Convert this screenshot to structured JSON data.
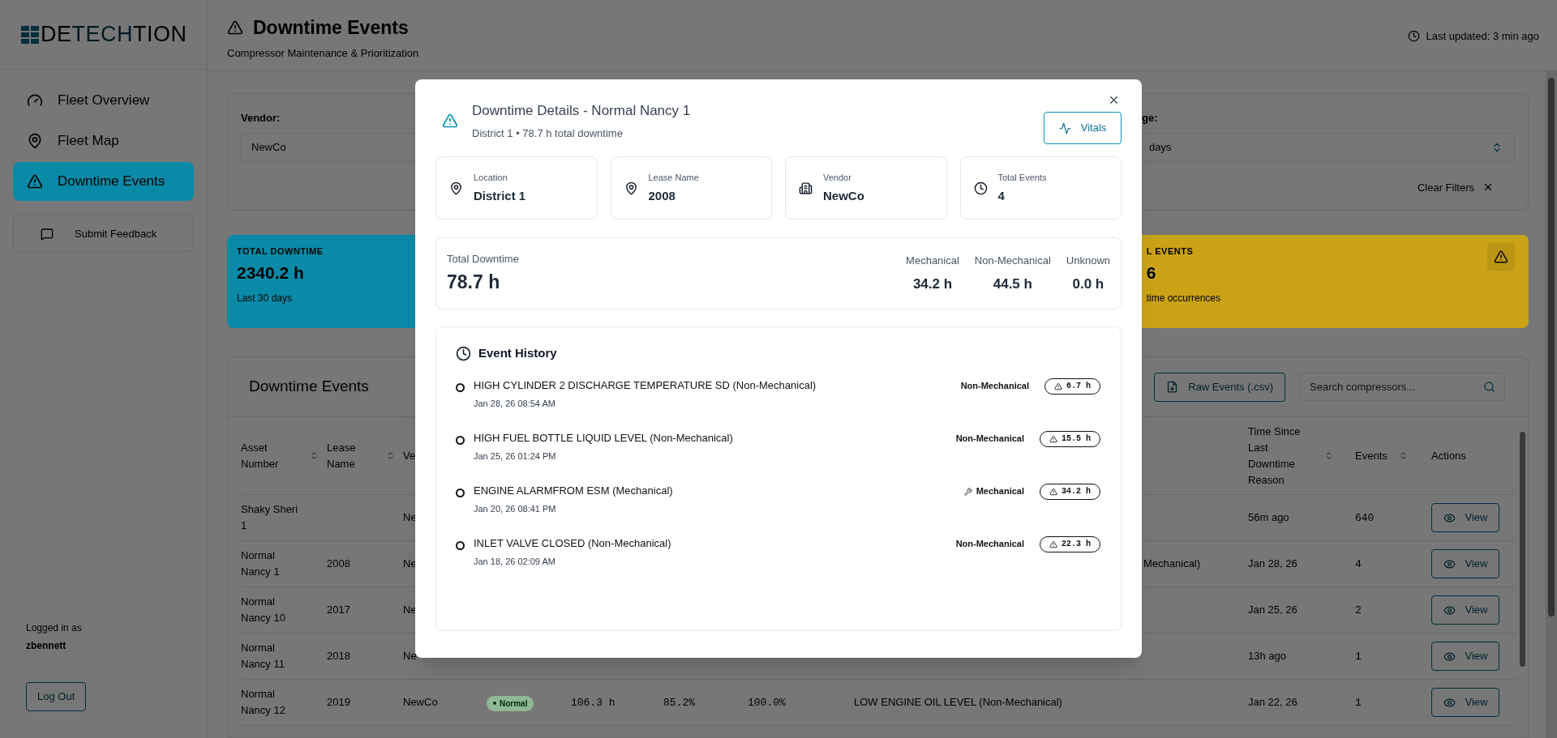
{
  "sidebar": {
    "logo": [
      {
        "text": "DE",
        "accent": false
      },
      {
        "text": "TECH",
        "accent": true
      },
      {
        "text": "TION",
        "accent": false
      }
    ],
    "nav": [
      {
        "label": "Fleet Overview",
        "selected": false
      },
      {
        "label": "Fleet Map",
        "selected": false
      },
      {
        "label": "Downtime Events",
        "selected": true
      }
    ],
    "feedback_button": "Submit Feedback",
    "user": {
      "caption": "Logged in as",
      "name": "zbennett"
    },
    "logout_button": "Log Out"
  },
  "header": {
    "title": "Downtime Events",
    "subtitle": "Compressor Maintenance & Prioritization",
    "last_updated": "Last updated: 3 min ago"
  },
  "filters": {
    "vendor": {
      "label": "Vendor:",
      "value": "NewCo"
    },
    "range": {
      "label": "ge:",
      "value": "days"
    },
    "clear_button": "Clear Filters"
  },
  "stats": [
    {
      "kind": "teal",
      "label": "TOTAL DOWNTIME",
      "value": "2340.2 h",
      "caption": "Last 30 days"
    },
    {
      "kind": "yellow",
      "label": "L EVENTS",
      "value": "6",
      "caption": "time occurrences"
    }
  ],
  "table": {
    "title": "Downtime Events",
    "export_button": "Raw Events (.csv)",
    "search_placeholder": "Search compressors...",
    "columns_left": [
      {
        "label": "Asset Number",
        "sortable": true
      },
      {
        "label": "Lease Name",
        "sortable": true
      },
      {
        "label": "Ve"
      }
    ],
    "columns_right": [
      {
        "label": "Time Since Last Downtime Reason",
        "sortable": true
      },
      {
        "label": "Events",
        "sortable": true
      },
      {
        "label": "Actions",
        "sortable": false
      }
    ],
    "rows": [
      {
        "asset_number": "Shaky Sheri 1",
        "vendor": "Ne",
        "time_since": "56m ago",
        "events": "640",
        "action": "View"
      },
      {
        "asset_number": "Normal Nancy 1",
        "lease_name": "2008",
        "vendor": "Ne",
        "column_8": "Mechanical)",
        "time_since": "Jan 28, 26",
        "events": "4",
        "action": "View"
      },
      {
        "asset_number": "Normal Nancy 10",
        "lease_name": "2017",
        "vendor": "Ne",
        "time_since": "Jan 25, 26",
        "events": "2",
        "action": "View"
      },
      {
        "asset_number": "Normal Nancy 11",
        "lease_name": "2018",
        "vendor": "Ne",
        "time_since": "13h ago",
        "events": "1",
        "action": "View"
      },
      {
        "asset_number": "Normal Nancy 12",
        "lease_name": "2019",
        "vendor": "NewCo",
        "column_4": "Normal",
        "column_5": "106.3 h",
        "column_6": "85.2%",
        "column_7": "100.0%",
        "column_8": "LOW ENGINE OIL LEVEL (Non-Mechanical)",
        "time_since": "Jan 22, 26",
        "events": "1",
        "action": "View"
      }
    ]
  },
  "modal": {
    "title": "Downtime Details - Normal Nancy 1",
    "subtitle": "District 1 • 78.7 h total downtime",
    "vitals_button": "Vitals",
    "info": [
      {
        "label": "Location",
        "value": "District 1"
      },
      {
        "label": "Lease Name",
        "value": "2008"
      },
      {
        "label": "Vendor",
        "value": "NewCo"
      },
      {
        "label": "Total Events",
        "value": "4"
      }
    ],
    "summary": {
      "label": "Total Downtime",
      "value": "78.7 h",
      "breakdown": [
        {
          "label": "Mechanical",
          "value": "34.2 h"
        },
        {
          "label": "Non-Mechanical",
          "value": "44.5 h"
        },
        {
          "label": "Unknown",
          "value": "0.0 h"
        }
      ]
    },
    "history": {
      "title": "Event History",
      "events": [
        {
          "kind": "non_mechanical",
          "title": "HIGH CYLINDER 2 DISCHARGE TEMPERATURE SD (Non-Mechanical)",
          "time": "Jan 28, 26 08:54 AM",
          "category": "Non-Mechanical",
          "duration": "6.7 h"
        },
        {
          "kind": "non_mechanical",
          "title": "HIGH FUEL BOTTLE LIQUID LEVEL (Non-Mechanical)",
          "time": "Jan 25, 26 01:24 PM",
          "category": "Non-Mechanical",
          "duration": "15.5 h"
        },
        {
          "kind": "mechanical",
          "title": "ENGINE ALARMFROM ESM (Mechanical)",
          "time": "Jan 20, 26 08:41 PM",
          "category": "Mechanical",
          "duration": "34.2 h"
        },
        {
          "kind": "non_mechanical",
          "title": "INLET VALVE CLOSED (Non-Mechanical)",
          "time": "Jan 18, 26 02:09 AM",
          "category": "Non-Mechanical",
          "duration": "22.3 h"
        }
      ]
    }
  }
}
